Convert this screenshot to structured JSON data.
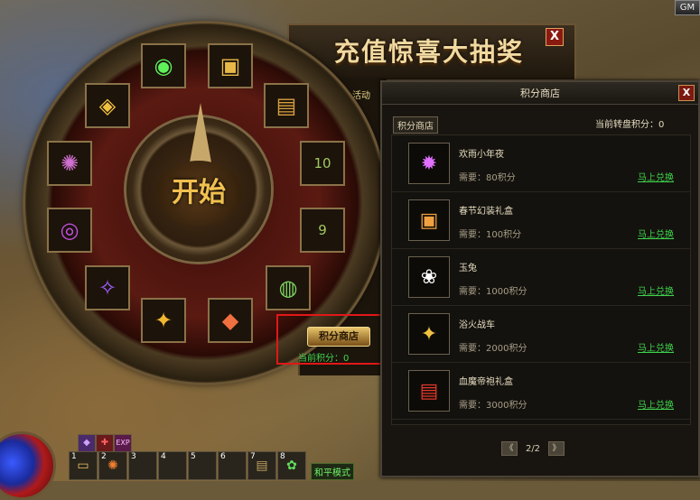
{
  "hud": {
    "gm_label": "GM",
    "mode_label": "和平模式"
  },
  "lottery": {
    "title": "充值惊喜大抽奖",
    "close": "X",
    "activity_label": "活动",
    "start_label": "开始",
    "shop_button": "积分商店",
    "current_points": "当前积分：0",
    "prize_icons": [
      "green-orb-icon",
      "treasure-chest-icon",
      "locked-chest-icon",
      "stone-10-icon",
      "stone-9-icon",
      "jade-disc-icon",
      "crystal-gem-icon",
      "golden-feather-icon",
      "comet-icon",
      "purple-orb-icon",
      "magic-crest-icon",
      "golden-box-icon"
    ]
  },
  "shop": {
    "title": "积分商店",
    "close": "X",
    "tab_label": "积分商店",
    "points_info": "当前转盘积分：0",
    "items": [
      {
        "name": "欢雨小年夜",
        "cost": "需要：80积分",
        "redeem": "马上兑换",
        "icon": "fireworks-icon"
      },
      {
        "name": "春节幻装礼盒",
        "cost": "需要：100积分",
        "redeem": "马上兑换",
        "icon": "gift-box-icon"
      },
      {
        "name": "玉兔",
        "cost": "需要：1000积分",
        "redeem": "马上兑换",
        "icon": "jade-rabbit-icon"
      },
      {
        "name": "浴火战车",
        "cost": "需要：2000积分",
        "redeem": "马上兑换",
        "icon": "chariot-icon"
      },
      {
        "name": "血魔帝袍礼盒",
        "cost": "需要：3000积分",
        "redeem": "马上兑换",
        "icon": "red-chest-icon"
      }
    ],
    "pager": {
      "prev": "《",
      "page": "2/2",
      "next": "》"
    }
  },
  "hotbar": [
    "1",
    "2",
    "3",
    "4",
    "5",
    "6",
    "7",
    "8"
  ],
  "colors": {
    "accent_green": "#3fd44c",
    "gold": "#f0c050",
    "highlight_red": "#e01818"
  }
}
